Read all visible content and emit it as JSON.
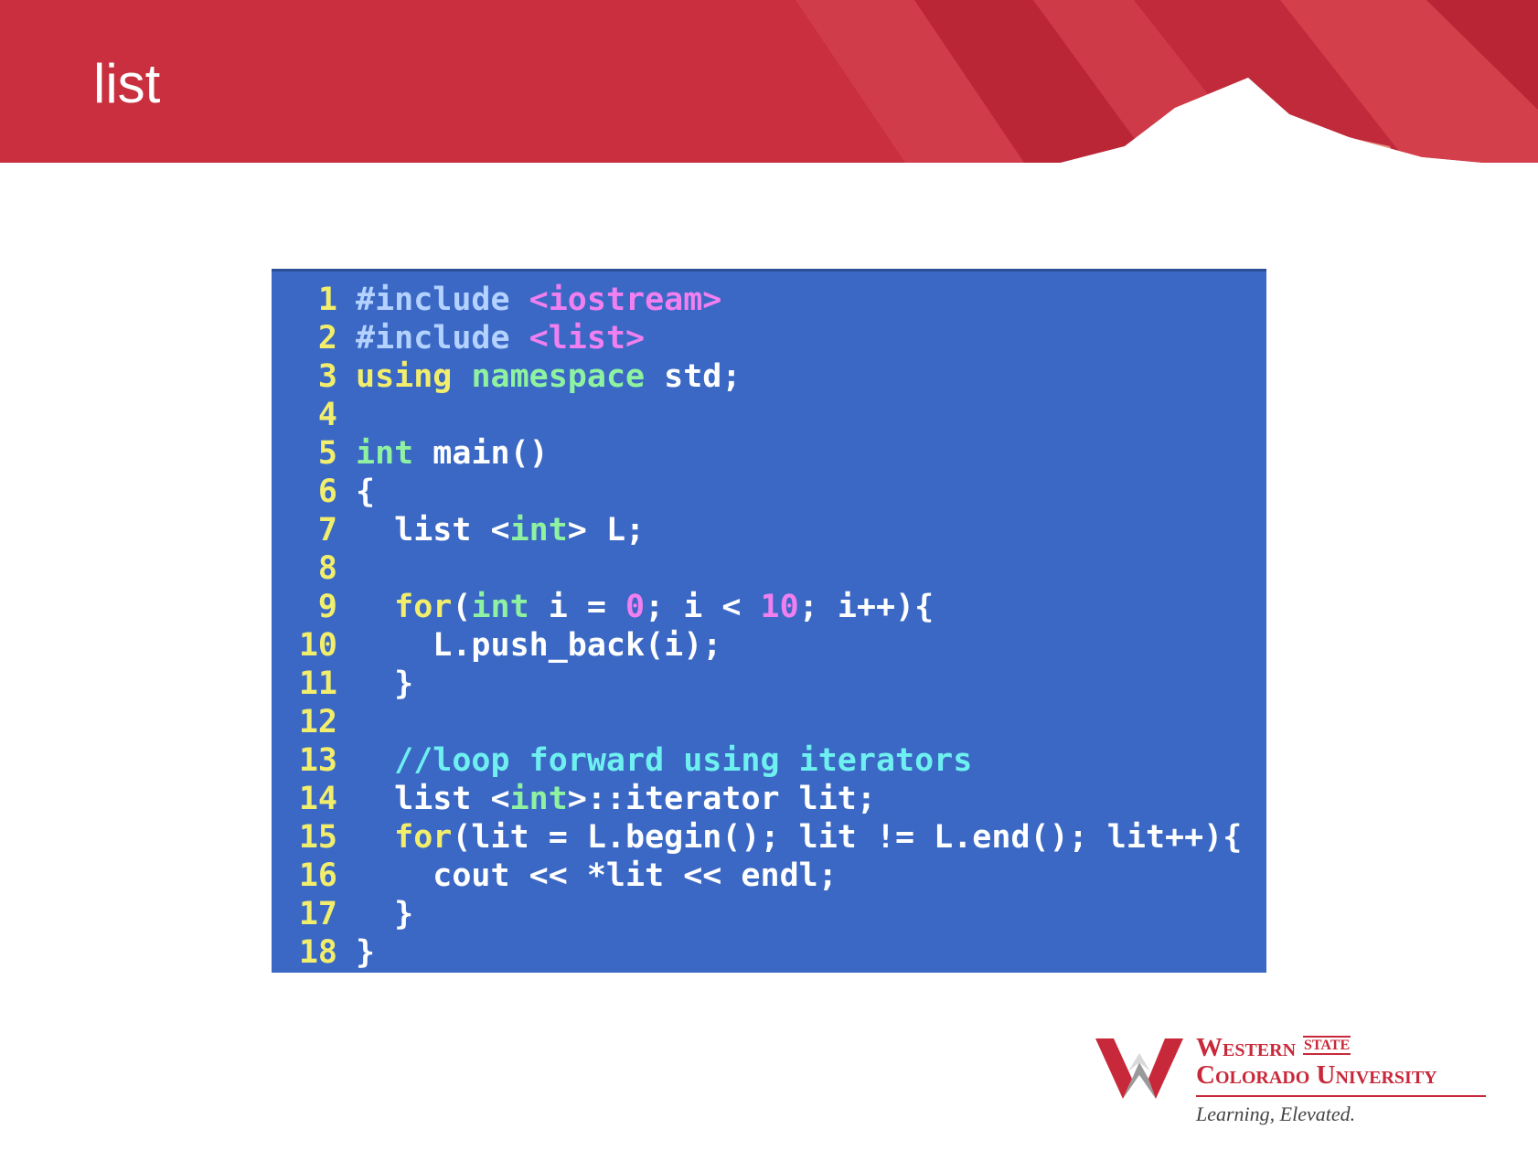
{
  "slide": {
    "title": "list"
  },
  "code": {
    "lines": [
      {
        "num": "1",
        "tokens": [
          [
            "pre",
            "#include "
          ],
          [
            "str",
            "<iostream>"
          ]
        ]
      },
      {
        "num": "2",
        "tokens": [
          [
            "pre",
            "#include "
          ],
          [
            "str",
            "<list>"
          ]
        ]
      },
      {
        "num": "3",
        "tokens": [
          [
            "kw",
            "using "
          ],
          [
            "type",
            "namespace "
          ],
          [
            "plain",
            "std;"
          ]
        ]
      },
      {
        "num": "4",
        "tokens": []
      },
      {
        "num": "5",
        "tokens": [
          [
            "type",
            "int "
          ],
          [
            "plain",
            "main()"
          ]
        ]
      },
      {
        "num": "6",
        "tokens": [
          [
            "plain",
            "{"
          ]
        ]
      },
      {
        "num": "7",
        "tokens": [
          [
            "plain",
            "  list <"
          ],
          [
            "type",
            "int"
          ],
          [
            "plain",
            "> L;"
          ]
        ]
      },
      {
        "num": "8",
        "tokens": []
      },
      {
        "num": "9",
        "tokens": [
          [
            "kw",
            "  for"
          ],
          [
            "plain",
            "("
          ],
          [
            "type",
            "int "
          ],
          [
            "plain",
            "i = "
          ],
          [
            "num",
            "0"
          ],
          [
            "plain",
            "; i < "
          ],
          [
            "num",
            "10"
          ],
          [
            "plain",
            "; i++){"
          ]
        ]
      },
      {
        "num": "10",
        "tokens": [
          [
            "plain",
            "    L.push_back(i);"
          ]
        ]
      },
      {
        "num": "11",
        "tokens": [
          [
            "plain",
            "  }"
          ]
        ]
      },
      {
        "num": "12",
        "tokens": []
      },
      {
        "num": "13",
        "tokens": [
          [
            "cm",
            "  //loop forward using iterators"
          ]
        ]
      },
      {
        "num": "14",
        "tokens": [
          [
            "plain",
            "  list <"
          ],
          [
            "type",
            "int"
          ],
          [
            "plain",
            ">::iterator lit;"
          ]
        ]
      },
      {
        "num": "15",
        "tokens": [
          [
            "kw",
            "  for"
          ],
          [
            "plain",
            "(lit = L.begin(); lit != L.end(); lit++){"
          ]
        ]
      },
      {
        "num": "16",
        "tokens": [
          [
            "plain",
            "    cout << *lit << endl;"
          ]
        ]
      },
      {
        "num": "17",
        "tokens": [
          [
            "plain",
            "  }"
          ]
        ]
      },
      {
        "num": "18",
        "tokens": [
          [
            "plain",
            "}"
          ]
        ]
      }
    ]
  },
  "logo": {
    "name_line1": "Western",
    "state_label": "STATE",
    "name_line2": "Colorado University",
    "tagline": "Learning, Elevated.",
    "brand_color": "#c8293a"
  },
  "colors": {
    "banner_red": "#c92f3e",
    "code_background": "#3a68c4"
  }
}
